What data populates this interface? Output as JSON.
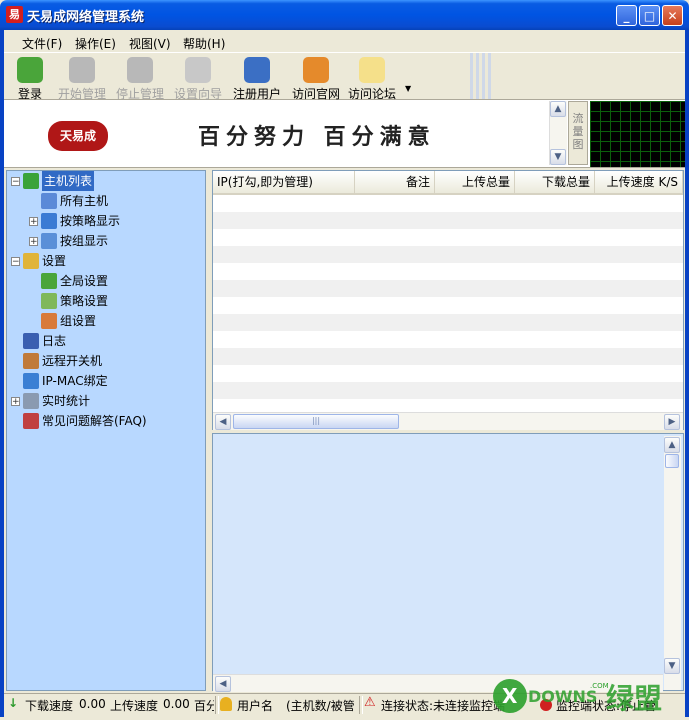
{
  "window": {
    "title": "天易成网络管理系统",
    "app_icon_char": "易",
    "minimize": "_",
    "maximize": "□",
    "close": "✕"
  },
  "menu": [
    "文件(F)",
    "操作(E)",
    "视图(V)",
    "帮助(H)"
  ],
  "toolbar": [
    {
      "label": "登录",
      "icon": "login-icon",
      "color": "#4aa53a",
      "enabled": true
    },
    {
      "label": "开始管理",
      "icon": "start-icon",
      "color": "#b8b8b8",
      "enabled": false
    },
    {
      "label": "停止管理",
      "icon": "stop-icon",
      "color": "#b8b8b8",
      "enabled": false
    },
    {
      "label": "设置向导",
      "icon": "wizard-icon",
      "color": "#c8c8c8",
      "enabled": false
    },
    {
      "label": "注册用户",
      "icon": "user-icon",
      "color": "#3b6fc4",
      "enabled": true
    },
    {
      "label": "访问官网",
      "icon": "home-icon",
      "color": "#e58a2b",
      "enabled": true
    },
    {
      "label": "访问论坛",
      "icon": "forum-icon",
      "color": "#f5e08a",
      "enabled": true
    }
  ],
  "banner": {
    "logo_text": "天易成",
    "slogan": "百分努力 百分满意",
    "flow_tab": "流量图"
  },
  "tree": [
    {
      "label": "主机列表",
      "level": 0,
      "expander": "−",
      "icon": "host-list-icon",
      "color": "#3aa33a",
      "selected": true
    },
    {
      "label": "所有主机",
      "level": 1,
      "expander": "",
      "icon": "all-hosts-icon",
      "color": "#5b8ad8",
      "selected": false
    },
    {
      "label": "按策略显示",
      "level": 1,
      "expander": "+",
      "icon": "policy-display-icon",
      "color": "#3b7bd4",
      "selected": false
    },
    {
      "label": "按组显示",
      "level": 1,
      "expander": "+",
      "icon": "group-display-icon",
      "color": "#5a8fd8",
      "selected": false
    },
    {
      "label": "设置",
      "level": 0,
      "expander": "−",
      "icon": "settings-icon",
      "color": "#e0b43a",
      "selected": false
    },
    {
      "label": "全局设置",
      "level": 1,
      "expander": "",
      "icon": "global-settings-icon",
      "color": "#4aa53a",
      "selected": false
    },
    {
      "label": "策略设置",
      "level": 1,
      "expander": "",
      "icon": "policy-settings-icon",
      "color": "#7fb85a",
      "selected": false
    },
    {
      "label": "组设置",
      "level": 1,
      "expander": "",
      "icon": "group-settings-icon",
      "color": "#d87a3a",
      "selected": false
    },
    {
      "label": "日志",
      "level": 0,
      "expander": "",
      "icon": "log-icon",
      "color": "#3a5fb0",
      "selected": false
    },
    {
      "label": "远程开关机",
      "level": 0,
      "expander": "",
      "icon": "remote-power-icon",
      "color": "#c07a3a",
      "selected": false
    },
    {
      "label": "IP-MAC绑定",
      "level": 0,
      "expander": "",
      "icon": "ip-mac-icon",
      "color": "#3a7fd4",
      "selected": false
    },
    {
      "label": "实时统计",
      "level": 0,
      "expander": "+",
      "icon": "realtime-stats-icon",
      "color": "#8a9ab0",
      "selected": false
    },
    {
      "label": "常见问题解答(FAQ)",
      "level": 0,
      "expander": "",
      "icon": "faq-icon",
      "color": "#c04040",
      "selected": false
    }
  ],
  "table": {
    "columns": [
      "IP(打勾,即为管理)",
      "备注",
      "上传总量",
      "下载总量",
      "上传速度 K/S"
    ],
    "rows": []
  },
  "status": {
    "download_label": "下载速度",
    "download_value": "0.00",
    "upload_label": "上传速度",
    "upload_value": "0.00",
    "percent_label": "百分",
    "user_label": "用户名",
    "hosts_label": "(主机数/被管",
    "connection_label": "连接状态:未连接监控端",
    "monitor_label": "监控端状态:停止管"
  },
  "watermark": {
    "text": "XDOWNS绿盟",
    "suffix": ".COM"
  }
}
